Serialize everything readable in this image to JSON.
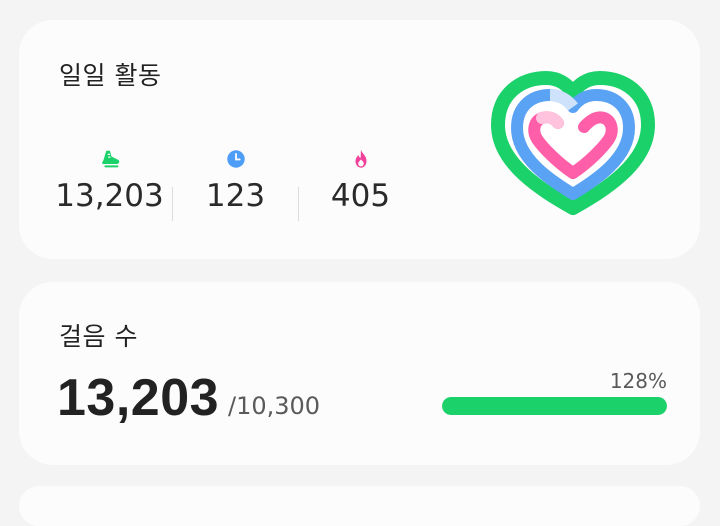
{
  "daily_activity": {
    "title": "일일 활동",
    "steps": "13,203",
    "active_minutes": "123",
    "calories": "405",
    "icons": {
      "steps": "shoe-icon",
      "minutes": "clock-icon",
      "calories": "flame-icon"
    }
  },
  "steps_card": {
    "title": "걸음 수",
    "count": "13,203",
    "goal": "/10,300",
    "percent_label": "128%",
    "progress_fraction": 1.0
  },
  "colors": {
    "steps_green": "#1bd16a",
    "minutes_blue": "#4e9df6",
    "calories_pink": "#f2419a",
    "heart_outer_green": "#1bd16a",
    "heart_blue": "#5aa2f4",
    "heart_pink": "#ff5fa8"
  }
}
